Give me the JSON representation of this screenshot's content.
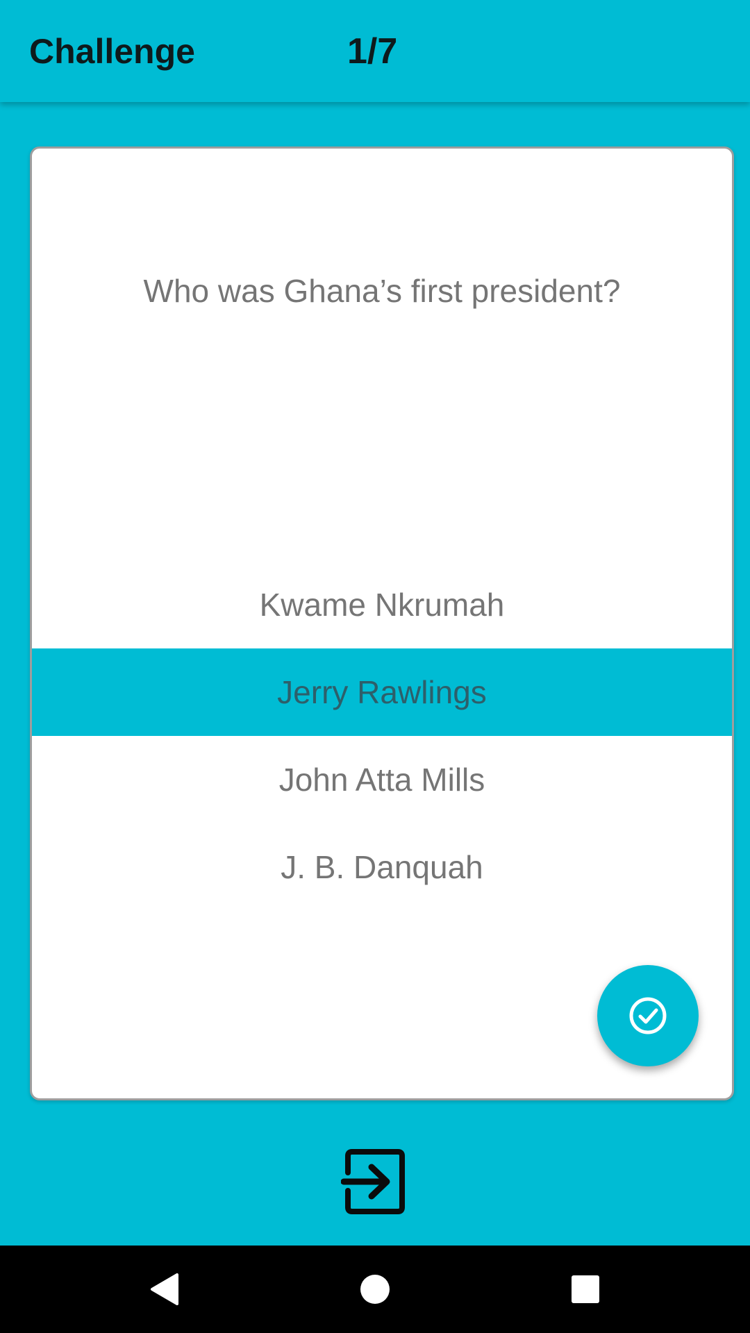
{
  "app_bar": {
    "title": "Challenge",
    "progress": "1/7"
  },
  "quiz": {
    "question": "Who was Ghana’s first president?",
    "options": [
      {
        "label": "Kwame Nkrumah",
        "selected": false
      },
      {
        "label": "Jerry Rawlings",
        "selected": true
      },
      {
        "label": "John Atta Mills",
        "selected": false
      },
      {
        "label": "J. B. Danquah",
        "selected": false
      }
    ]
  },
  "actions": {
    "submit_icon": "check-circle-icon",
    "exit_icon": "exit-to-app-icon"
  },
  "navigation": {
    "back_icon": "back-triangle-icon",
    "home_icon": "home-circle-icon",
    "recents_icon": "recents-square-icon"
  },
  "colors": {
    "accent": "#00BCD4",
    "text_muted": "#757575",
    "nav_bar": "#000000"
  }
}
